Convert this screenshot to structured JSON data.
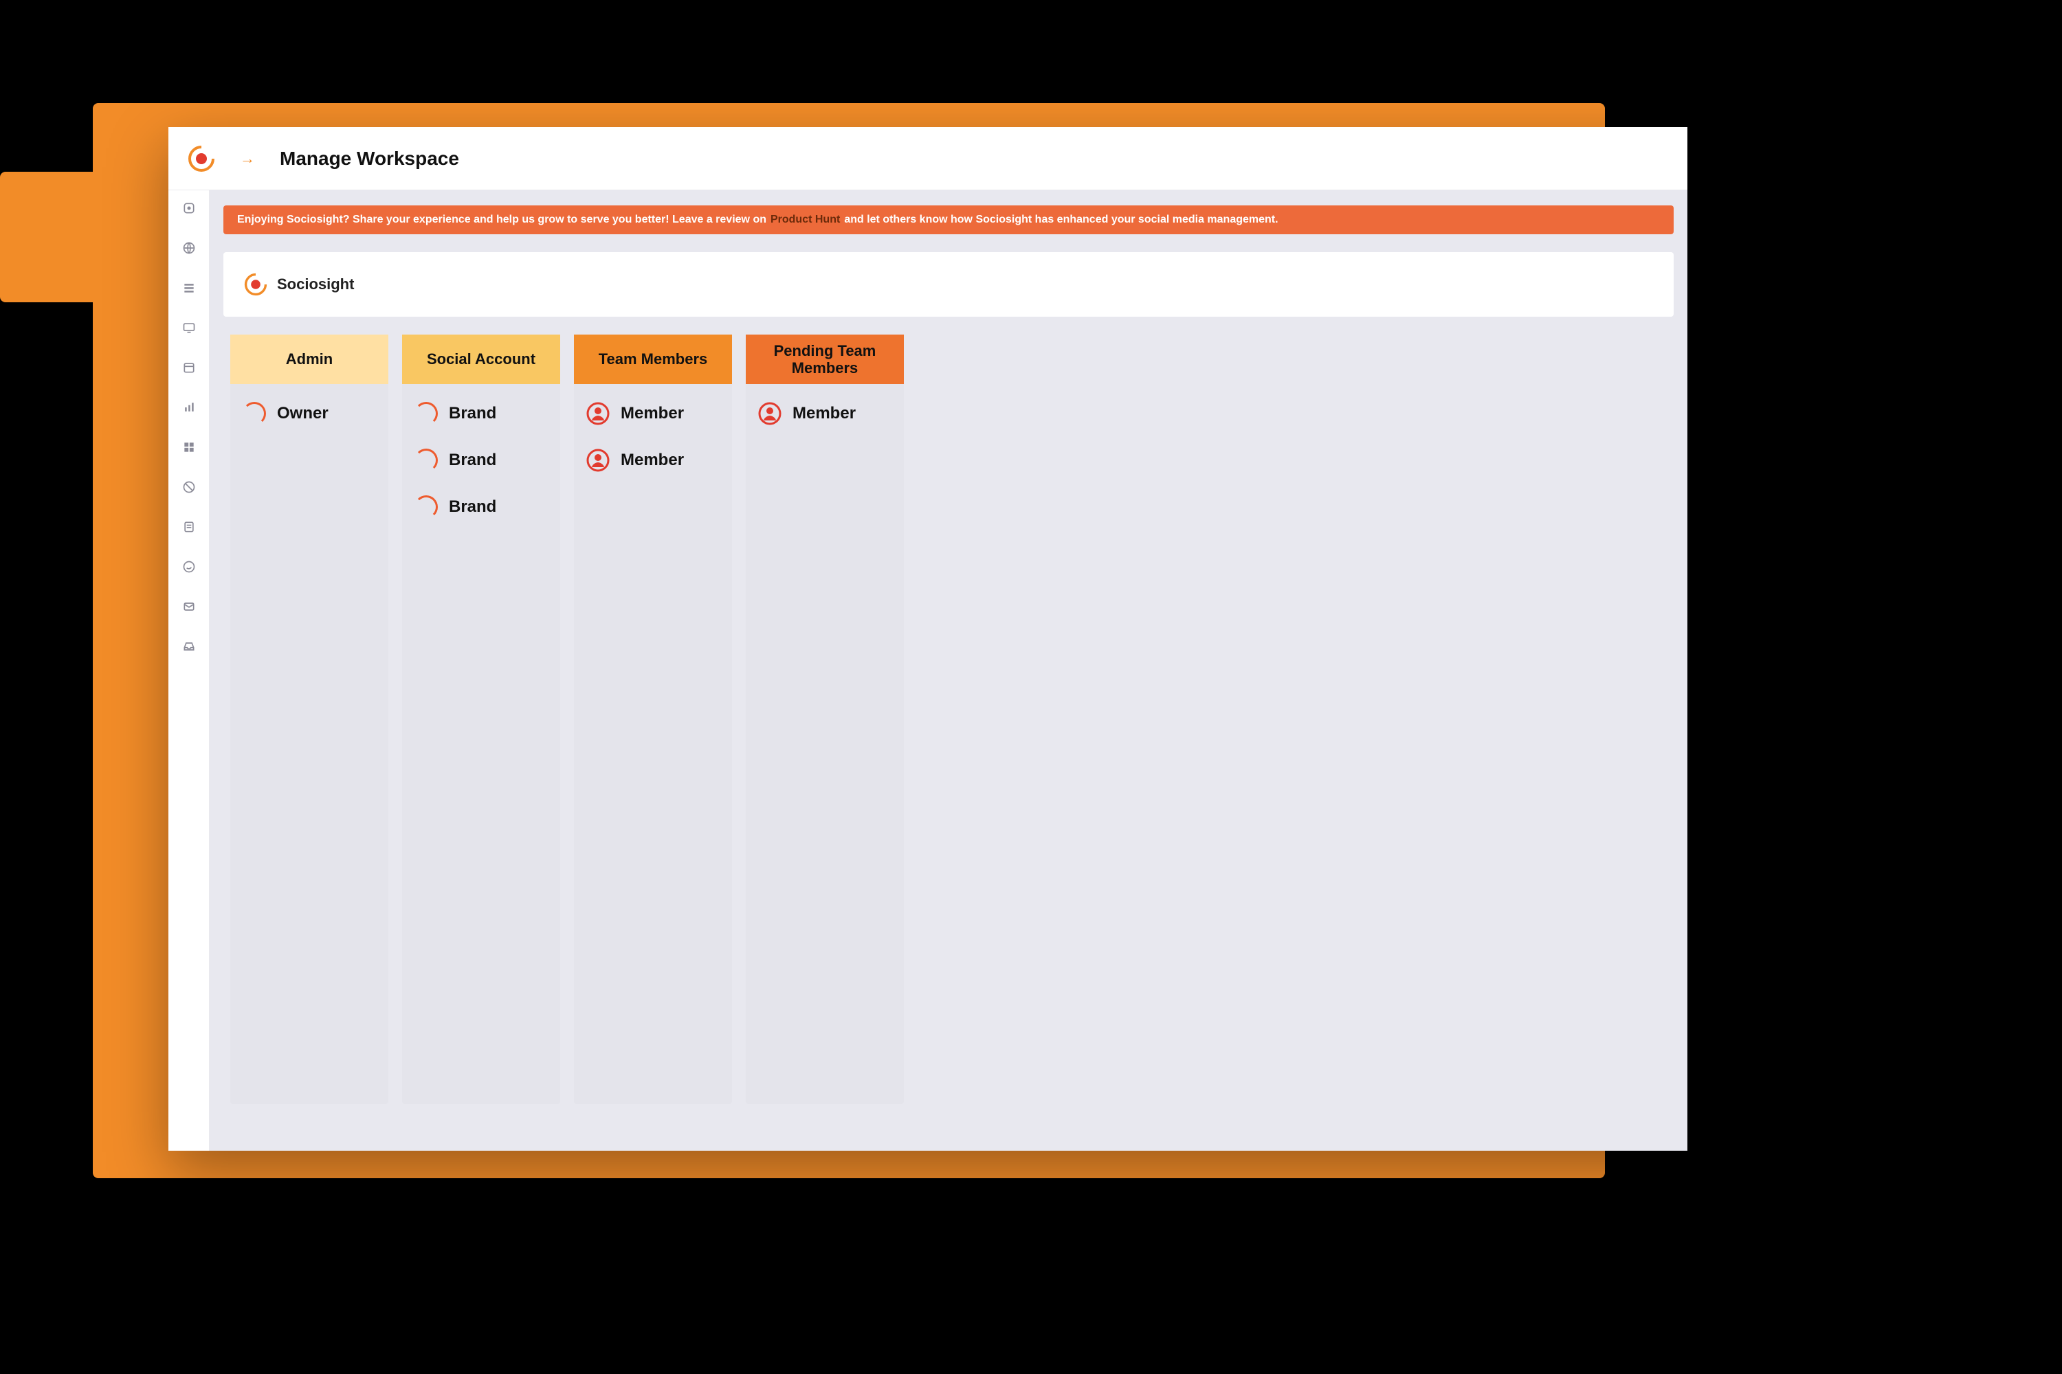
{
  "header": {
    "page_title": "Manage Workspace"
  },
  "banner": {
    "pre": "Enjoying Sociosight? Share your experience and help us grow to serve you better! Leave a review on",
    "link_label": "Product Hunt",
    "post": "and let others know how Sociosight has enhanced your social media management."
  },
  "workspace_card": {
    "brand_name": "Sociosight"
  },
  "columns": [
    {
      "title": "Admin",
      "items": [
        {
          "type": "spinner",
          "label": "Owner"
        }
      ]
    },
    {
      "title": "Social Account",
      "items": [
        {
          "type": "spinner",
          "label": "Brand"
        },
        {
          "type": "spinner",
          "label": "Brand"
        },
        {
          "type": "spinner",
          "label": "Brand"
        }
      ]
    },
    {
      "title": "Team Members",
      "items": [
        {
          "type": "user",
          "label": "Member"
        },
        {
          "type": "user",
          "label": "Member"
        }
      ]
    },
    {
      "title": "Pending Team Members",
      "items": [
        {
          "type": "user",
          "label": "Member"
        }
      ]
    }
  ],
  "sidebar": {
    "items": [
      {
        "name": "sidebar-item-brand"
      },
      {
        "name": "sidebar-item-globe"
      },
      {
        "name": "sidebar-item-list"
      },
      {
        "name": "sidebar-item-monitor"
      },
      {
        "name": "sidebar-item-calendar"
      },
      {
        "name": "sidebar-item-analytics"
      },
      {
        "name": "sidebar-item-ai"
      },
      {
        "name": "sidebar-item-moderation"
      },
      {
        "name": "sidebar-item-drafts"
      },
      {
        "name": "sidebar-item-whatsapp"
      },
      {
        "name": "sidebar-item-mail"
      },
      {
        "name": "sidebar-item-inbox"
      }
    ]
  }
}
